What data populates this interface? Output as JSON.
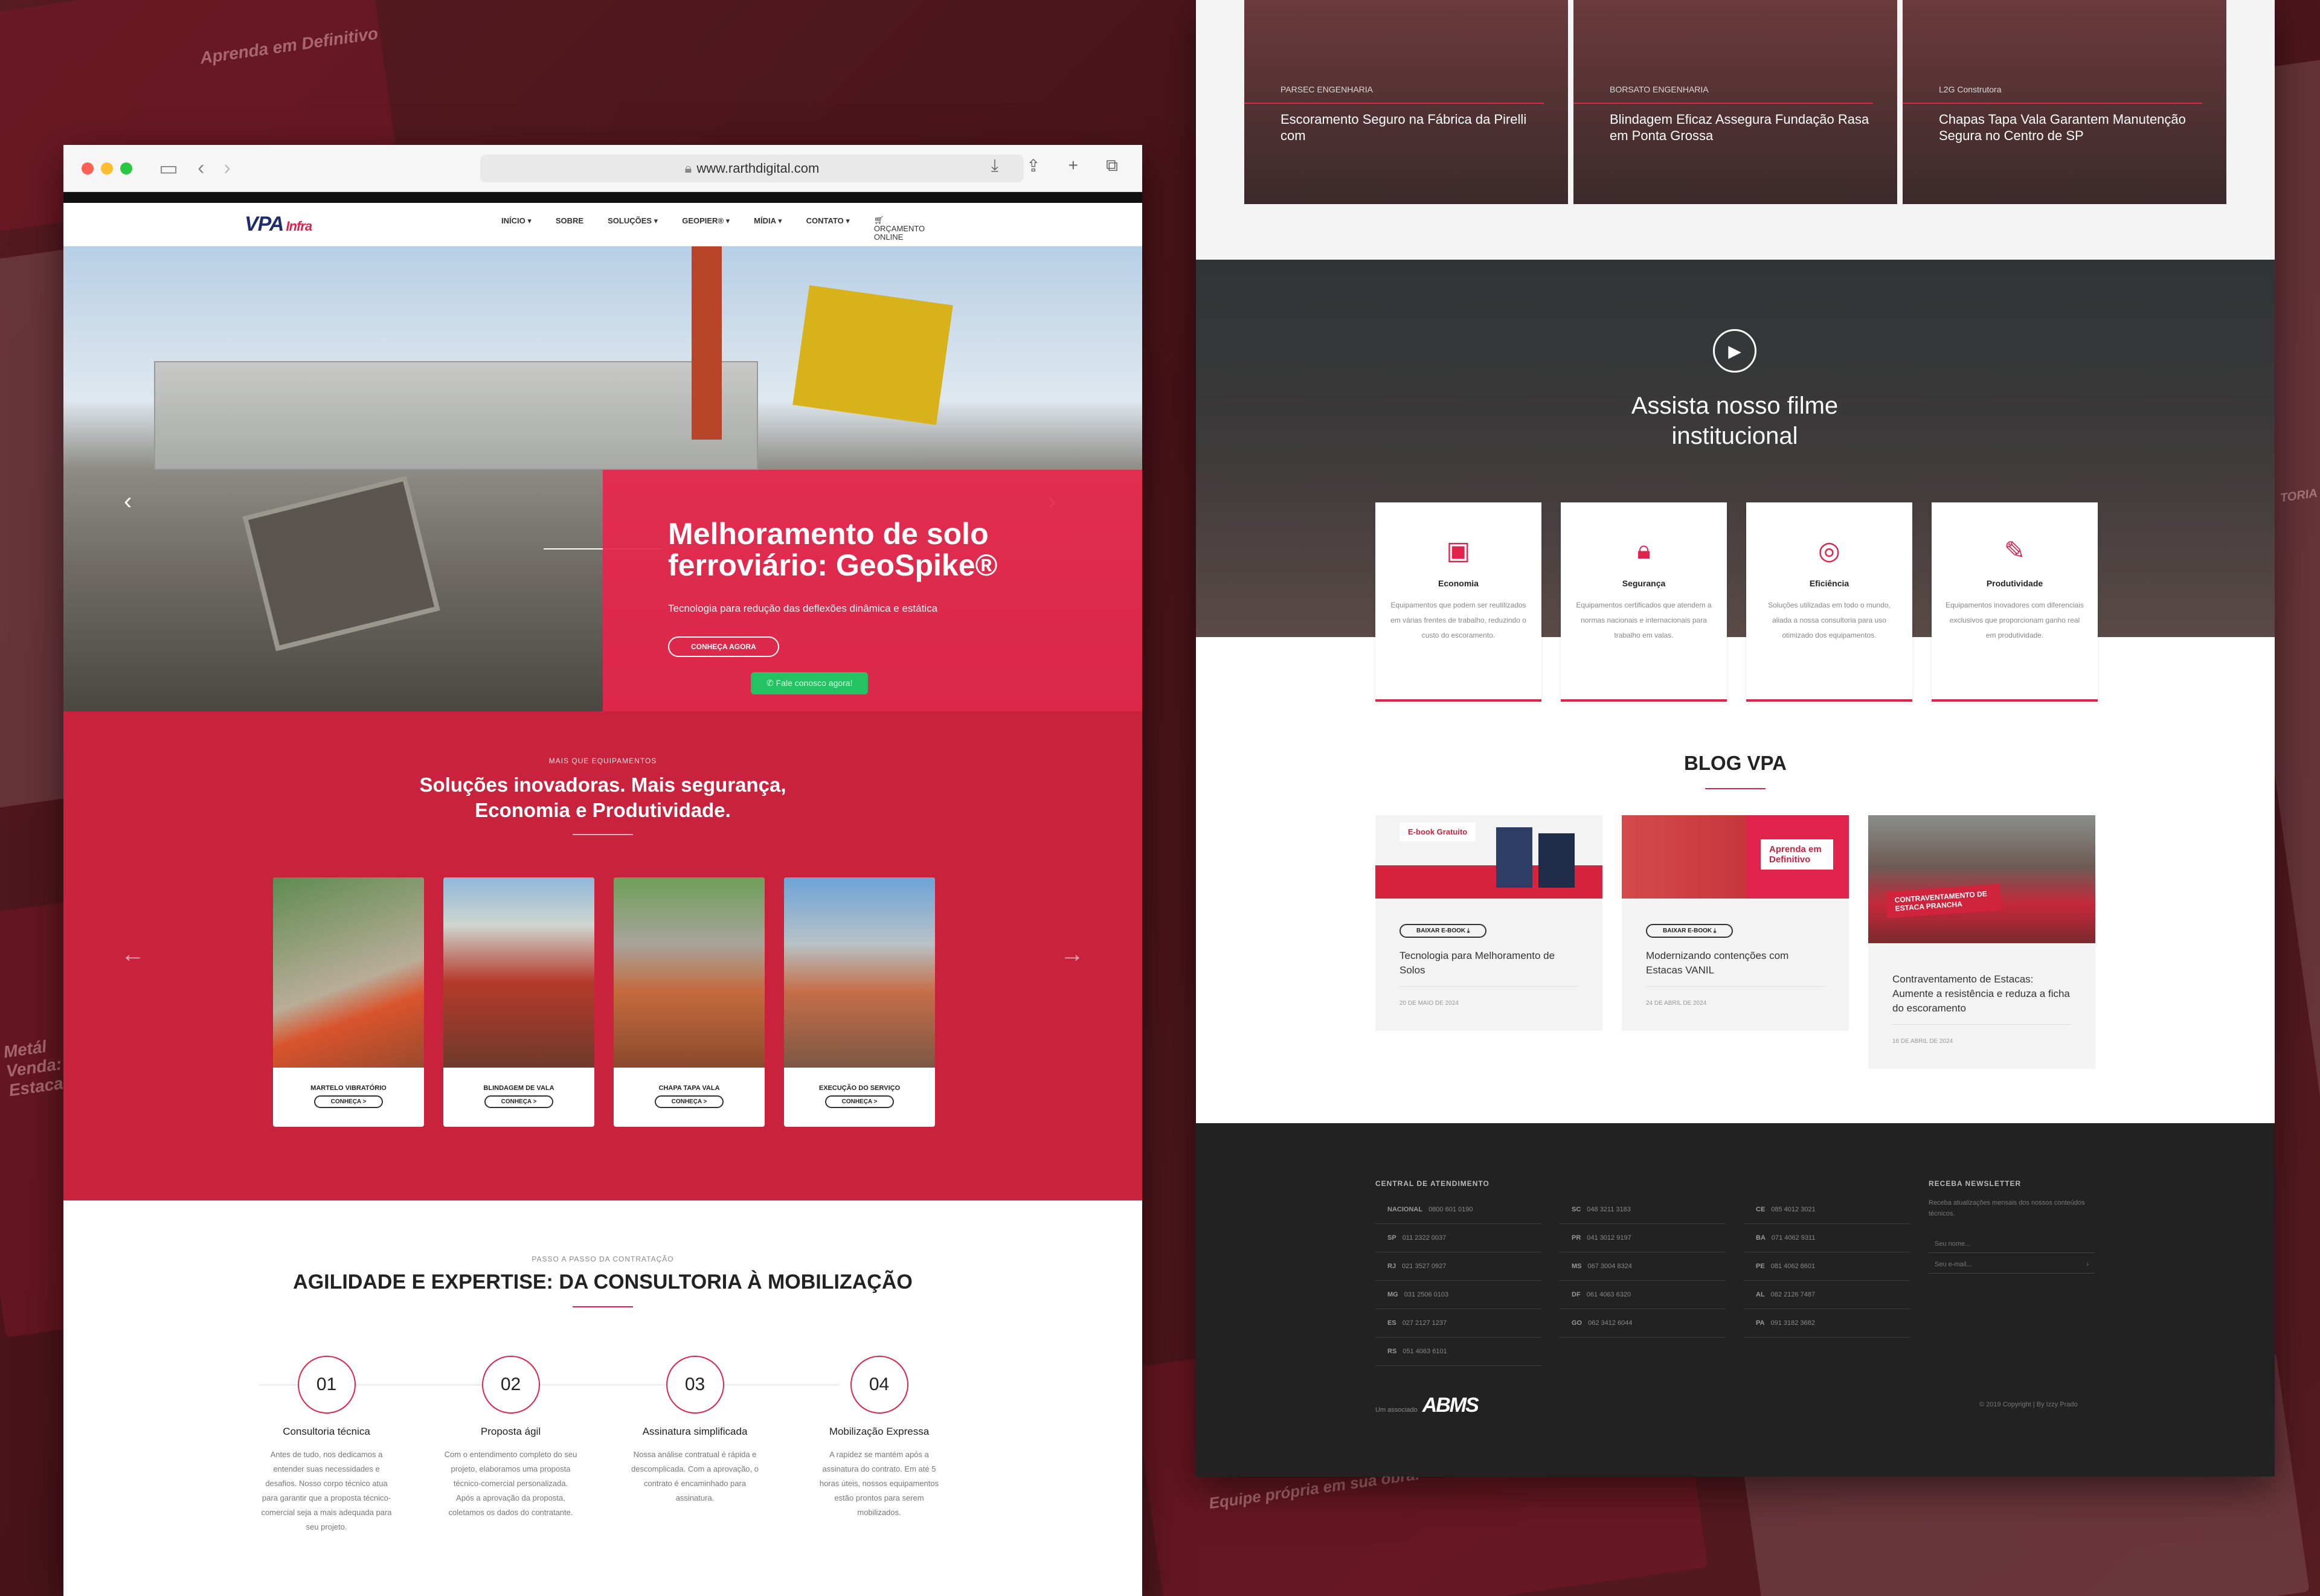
{
  "browser": {
    "url": "www.rarthdigital.com",
    "icons": {
      "sidebar": "sidebar-icon",
      "back": "chevron-left-icon",
      "forward": "chevron-right-icon",
      "download": "download-icon",
      "share": "share-icon",
      "new_tab": "plus-icon",
      "tabs": "tabs-icon"
    }
  },
  "site": {
    "logo": "VPA",
    "logo_sub": "Infra",
    "menu": [
      "INÍCIO ▾",
      "SOBRE",
      "SOLUÇÕES ▾",
      "GEOPIER® ▾",
      "MÍDIA ▾",
      "CONTATO ▾"
    ],
    "quote": "ORÇAMENTO ONLINE",
    "colors": {
      "primary": "#e0234a",
      "dark_red": "#c8223c",
      "navy": "#1f2d6b"
    }
  },
  "hero": {
    "title": "Melhoramento de solo ferroviário: GeoSpike®",
    "subtitle": "Tecnologia para redução das deflexões dinâmica e estática",
    "button": "CONHEÇA AGORA",
    "whatsapp": "Fale conosco agora!"
  },
  "solutions": {
    "kicker": "MAIS QUE EQUIPAMENTOS",
    "title": "Soluções inovadoras. Mais segurança, Economia e Produtividade.",
    "cards": [
      {
        "title": "MARTELO VIBRATÓRIO",
        "button": "CONHEÇA  >"
      },
      {
        "title": "BLINDAGEM DE VALA",
        "button": "CONHEÇA  >"
      },
      {
        "title": "CHAPA TAPA VALA",
        "button": "CONHEÇA  >"
      },
      {
        "title": "EXECUÇÃO DO SERVIÇO",
        "button": "CONHEÇA  >"
      }
    ]
  },
  "steps": {
    "kicker": "PASSO A PASSO DA CONTRATAÇÃO",
    "title": "AGILIDADE E EXPERTISE: DA CONSULTORIA À MOBILIZAÇÃO",
    "items": [
      {
        "num": "01",
        "title": "Consultoria técnica",
        "text": "Antes de tudo, nos dedicamos a entender suas necessidades e desafios. Nosso corpo técnico atua para garantir que a proposta técnico-comercial seja a mais adequada para seu projeto."
      },
      {
        "num": "02",
        "title": "Proposta ágil",
        "text": "Com o entendimento completo do seu projeto, elaboramos uma proposta técnico-comercial personalizada. Após a aprovação da proposta, coletamos os dados do contratante."
      },
      {
        "num": "03",
        "title": "Assinatura simplificada",
        "text": "Nossa análise contratual é rápida e descomplicada. Com a aprovação, o contrato é encaminhado para assinatura."
      },
      {
        "num": "04",
        "title": "Mobilização Expressa",
        "text": "A rapidez se mantém após a assinatura do contrato. Em até 5 horas úteis, nossos equipamentos estão prontos para serem mobilizados."
      }
    ]
  },
  "right": {
    "top_posts": [
      {
        "source": "PARSEC ENGENHARIA",
        "title": "Escoramento Seguro na Fábrica da Pirelli com"
      },
      {
        "source": "BORSATO ENGENHARIA",
        "title": "Blindagem Eficaz Assegura Fundação Rasa em Ponta Grossa"
      },
      {
        "source": "L2G Construtora",
        "title": "Chapas Tapa Vala Garantem Manutenção Segura no Centro de SP"
      }
    ],
    "video_title": "Assista nosso filme institucional",
    "features": [
      {
        "icon": "wallet-icon",
        "title": "Economia",
        "text": "Equipamentos que podem ser reutilizados em várias frentes de trabalho, reduzindo o custo do escoramento."
      },
      {
        "icon": "lock-icon",
        "title": "Segurança",
        "text": "Equipamentos certificados que atendem a normas nacionais e internacionais para trabalho em valas."
      },
      {
        "icon": "target-icon",
        "title": "Eficiência",
        "text": "Soluções utilizadas em todo o mundo, aliada a nossa consultoria para uso otimizado dos equipamentos."
      },
      {
        "icon": "tools-icon",
        "title": "Produtividade",
        "text": "Equipamentos inovadores com diferenciais exclusivos que proporcionam ganho real em produtividade."
      }
    ],
    "blog_title": "BLOG VPA",
    "posts": [
      {
        "badge": "E-book Gratuito",
        "tag": "BAIXAR E-BOOK",
        "title": "Tecnologia para Melhoramento de Solos",
        "date": "20 DE MAIO DE 2024"
      },
      {
        "badge": "Aprenda em Definitivo",
        "tag": "BAIXAR E-BOOK",
        "title": "Modernizando contenções com Estacas VANIL",
        "date": "24 DE ABRIL DE 2024"
      },
      {
        "badge": "CONTRAVENTAMENTO DE ESTACA PRANCHA",
        "tag": "",
        "title": "Contraventamento de Estacas: Aumente a resistência e reduza a ficha do escoramento",
        "date": "16 DE ABRIL DE 2024"
      }
    ],
    "footer": {
      "central": "CENTRAL DE ATENDIMENTO",
      "col1": [
        {
          "uf": "NACIONAL",
          "phone": "0800 601 0190"
        },
        {
          "uf": "SP",
          "phone": "011 2322 0037"
        },
        {
          "uf": "RJ",
          "phone": "021 3527 0927"
        },
        {
          "uf": "MG",
          "phone": "031 2506 0103"
        },
        {
          "uf": "ES",
          "phone": "027 2127 1237"
        },
        {
          "uf": "RS",
          "phone": "051 4063 6101"
        }
      ],
      "col2": [
        {
          "uf": "SC",
          "phone": "048 3211 3183"
        },
        {
          "uf": "PR",
          "phone": "041 3012 9197"
        },
        {
          "uf": "MS",
          "phone": "067 3004 8324"
        },
        {
          "uf": "DF",
          "phone": "061 4063 6320"
        },
        {
          "uf": "GO",
          "phone": "062 3412 6044"
        }
      ],
      "col3": [
        {
          "uf": "CE",
          "phone": "085 4012 3021"
        },
        {
          "uf": "BA",
          "phone": "071 4062 9311"
        },
        {
          "uf": "PE",
          "phone": "081 4062 8601"
        },
        {
          "uf": "AL",
          "phone": "082 2126 7487"
        },
        {
          "uf": "PA",
          "phone": "091 3182 3682"
        }
      ],
      "newsletter": "RECEBA NEWSLETTER",
      "newsletter_text": "Receba atualizações mensais dos nossos conteúdos técnicos.",
      "name_ph": "Seu nome...",
      "email_ph": "Seu e-mail...",
      "associate": "Um associado",
      "abms": "ABMS",
      "copyright": "© 2019 Copyright | By Izzy Prado"
    }
  },
  "background": {
    "fragments": [
      "Aprenda em Definitivo",
      "Metál Venda: Estacas",
      "TORIA",
      "Equipe própria em sua obra!"
    ]
  }
}
